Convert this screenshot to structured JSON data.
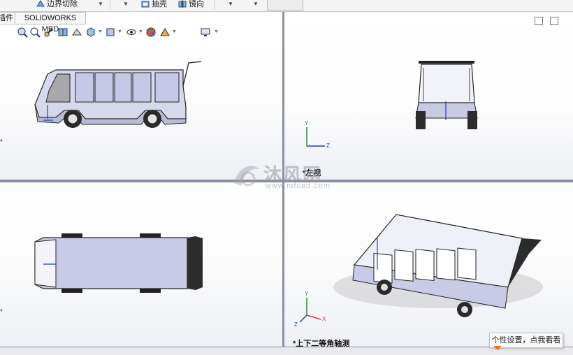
{
  "ribbon": {
    "items": [
      {
        "label": "边界切除",
        "icon": "boundary-cut-icon"
      },
      {
        "label": "抽壳",
        "icon": "shell-icon"
      },
      {
        "label": "镜向",
        "icon": "mirror-icon"
      }
    ]
  },
  "tabs": [
    {
      "label": "插件"
    },
    {
      "label": "SOLIDWORKS MBD"
    }
  ],
  "hud": {
    "icons": [
      "zoom-to-fit-icon",
      "zoom-to-area-icon",
      "previous-view-icon",
      "section-view-icon",
      "dynamic-annotation-icon",
      "view-orientation-icon",
      "display-style-icon",
      "hide-show-items-icon",
      "edit-appearance-icon",
      "apply-scene-icon",
      "view-settings-icon"
    ]
  },
  "viewports": {
    "top_right_label": "*左视",
    "bottom_right_label": "*上下二等角轴测",
    "left_edge_mark": "*"
  },
  "triad": {
    "x": "X",
    "y": "Y",
    "z": "Z"
  },
  "watermark": {
    "brand": "沐风网",
    "url": "www.mfcad.com"
  },
  "tooltip": {
    "text": "个性设置，点我看看"
  },
  "colors": {
    "body": "#c9cbe6",
    "outline": "#202020",
    "divider": "#8b8fa6",
    "accent": "#f26b2a"
  }
}
